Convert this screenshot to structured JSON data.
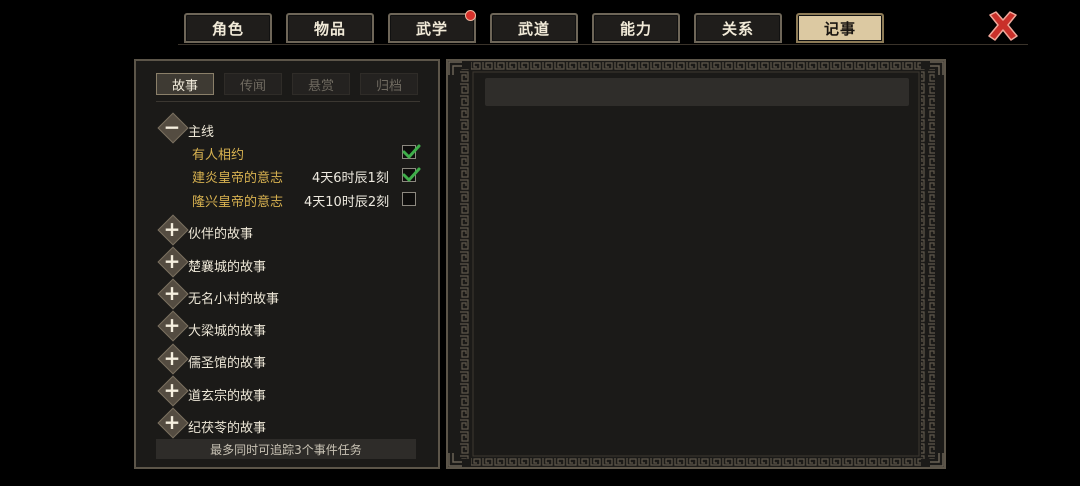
{
  "tabs": [
    {
      "label": "角色",
      "active": false,
      "badge": false
    },
    {
      "label": "物品",
      "active": false,
      "badge": false
    },
    {
      "label": "武学",
      "active": false,
      "badge": true
    },
    {
      "label": "武道",
      "active": false,
      "badge": false
    },
    {
      "label": "能力",
      "active": false,
      "badge": false
    },
    {
      "label": "关系",
      "active": false,
      "badge": false
    },
    {
      "label": "记事",
      "active": true,
      "badge": false
    }
  ],
  "close_icon": "red-x-icon",
  "subtabs": [
    {
      "label": "故事",
      "active": true
    },
    {
      "label": "传闻",
      "active": false
    },
    {
      "label": "悬赏",
      "active": false
    },
    {
      "label": "归档",
      "active": false
    }
  ],
  "main_line": {
    "label": "主线",
    "expanded": true,
    "quests": [
      {
        "title": "有人相约",
        "time": "",
        "tracked": true
      },
      {
        "title": "建炎皇帝的意志",
        "time": "4天6时辰1刻",
        "tracked": true
      },
      {
        "title": "隆兴皇帝的意志",
        "time": "4天10时辰2刻",
        "tracked": false
      }
    ]
  },
  "categories": [
    "伙伴的故事",
    "楚襄城的故事",
    "无名小村的故事",
    "大梁城的故事",
    "儒圣馆的故事",
    "道玄宗的故事",
    "纪茯苓的故事"
  ],
  "footer": "最多同时可追踪3个事件任务",
  "colors": {
    "accent_gold": "#d8b250",
    "active_tab": "#dcc9a2",
    "close_red": "#d8322c",
    "check_green": "#3fae4a"
  }
}
